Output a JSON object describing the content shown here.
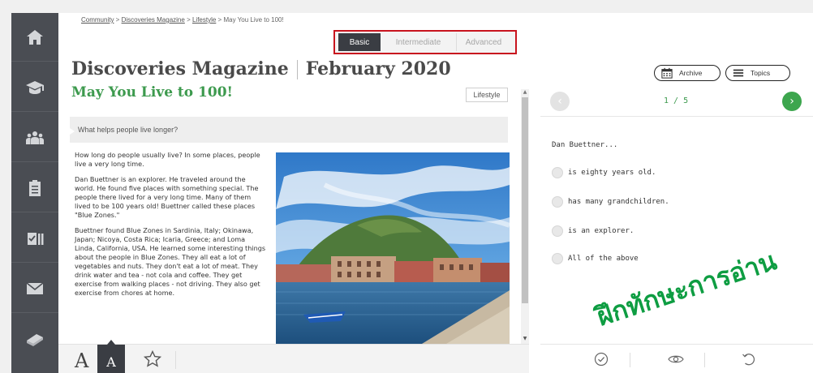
{
  "breadcrumb": {
    "items": [
      "Community",
      "Discoveries Magazine",
      "Lifestyle"
    ],
    "current": "May You Live to 100!"
  },
  "level_tabs": {
    "basic": "Basic",
    "intermediate": "Intermediate",
    "advanced": "Advanced"
  },
  "magazine": {
    "name": "Discoveries Magazine",
    "issue": "February 2020"
  },
  "article": {
    "title": "May You Live to 100!",
    "tag": "Lifestyle",
    "question": "What helps people live longer?",
    "paragraphs": [
      "How long do people usually live? In some places, people live a very long time.",
      "Dan Buettner is an explorer. He traveled around the world. He found five places with something special. The people there lived for a very long time. Many of them lived to be 100 years old! Buettner called these places \"Blue Zones.\"",
      "Buettner found Blue Zones in Sardinia, Italy; Okinawa, Japan; Nicoya, Costa Rica; Icaria, Greece; and Loma Linda, California, USA. He learned some interesting things about the people in Blue Zones. They all eat a lot of vegetables and nuts. They don't eat a lot of meat. They drink water and tea - not cola and coffee. They get exercise from walking places - not driving. They also get exercise from chores at home."
    ]
  },
  "font_controls": {
    "large": "A",
    "small": "A"
  },
  "quiz": {
    "archive_label": "Archive",
    "topics_label": "Topics",
    "page_count": "1 / 5",
    "prompt": "Dan Buettner...",
    "options": [
      "is eighty years old.",
      "has many grandchildren.",
      "is an explorer.",
      "All of the above"
    ]
  },
  "overlay": {
    "thai_text": "ฝึกทักษะการอ่าน",
    "color": "#0e9d42"
  },
  "colors": {
    "sidebar": "#4a4d53",
    "accent_green": "#3d9a4e",
    "highlight_red": "#c8141e"
  }
}
